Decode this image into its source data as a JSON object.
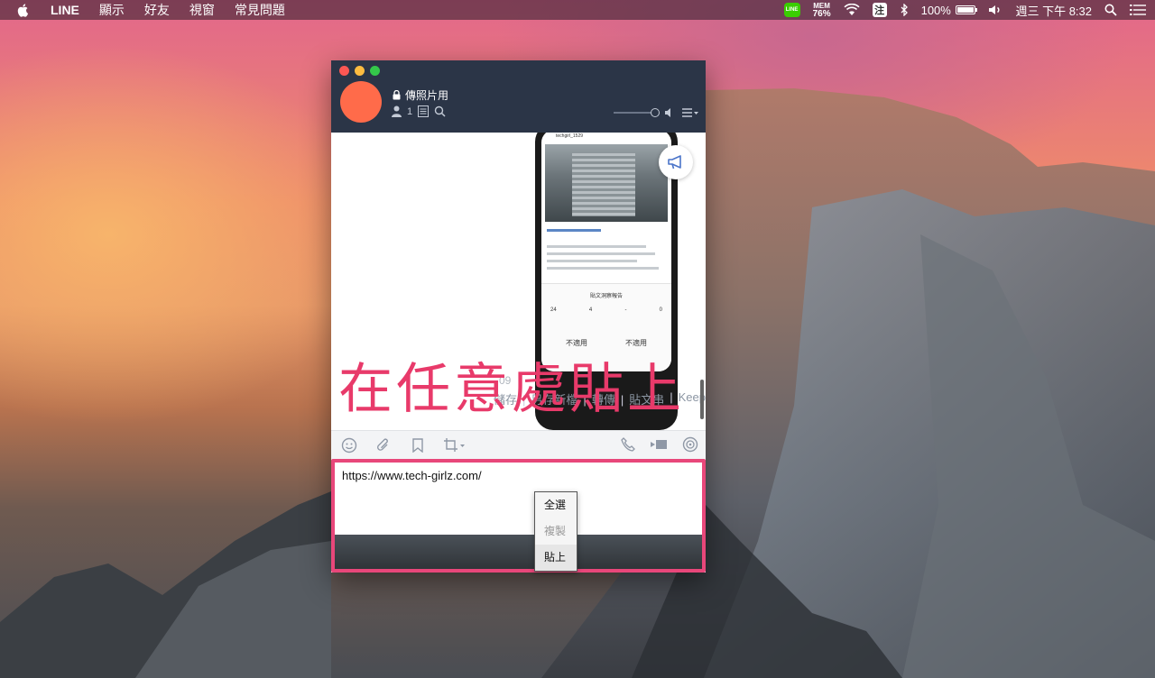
{
  "menubar": {
    "app": "LINE",
    "items": [
      "顯示",
      "好友",
      "視窗",
      "常見問題"
    ],
    "status": {
      "line_icon": "LINE",
      "mem_label": "MEM",
      "mem_value": "76%",
      "ime": "注",
      "battery": "100%",
      "battery_level": 1.0,
      "clock": "週三 下午 8:32"
    }
  },
  "chat": {
    "title": "傳照片用",
    "member_count": "1",
    "message_time": "09",
    "message_actions": [
      "儲存",
      "另存新檔",
      "轉傳",
      "貼文串",
      "Keep"
    ],
    "phone_preview": {
      "username": "techgirl_1529",
      "sheet_title": "貼文洞察報告",
      "stats": [
        "24",
        "4",
        "-",
        "0"
      ],
      "buttons": [
        {
          "label": "不適用"
        },
        {
          "label": "不適用"
        }
      ]
    }
  },
  "annotation": "在任意處貼上",
  "input": {
    "value": "https://www.tech-girlz.com/"
  },
  "context_menu": {
    "items": [
      "全選",
      "複製",
      "貼上"
    ]
  },
  "colors": {
    "header": "#2b3547",
    "annotation": "#e83a6a",
    "avatar": "#ff6b4a"
  }
}
